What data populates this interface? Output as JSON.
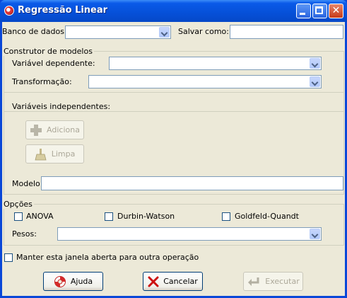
{
  "window": {
    "title": "Regressão Linear"
  },
  "top": {
    "banco_label": "Banco de dados:",
    "banco_value": "",
    "salvar_label": "Salvar como:",
    "salvar_value": ""
  },
  "builder": {
    "group_label": "Construtor de modelos",
    "dep_label": "Variável dependente:",
    "dep_value": "",
    "transf_label": "Transformação:",
    "transf_value": "",
    "indep_label": "Variáveis independentes:",
    "add_label": "Adiciona",
    "clear_label": "Limpa",
    "model_label": "Modelo:",
    "model_value": ""
  },
  "options": {
    "group_label": "Opções",
    "anova_label": "ANOVA",
    "anova_checked": false,
    "dw_label": "Durbin-Watson",
    "dw_checked": false,
    "gq_label": "Goldfeld-Quandt",
    "gq_checked": false,
    "pesos_label": "Pesos:",
    "pesos_value": ""
  },
  "keep_open": {
    "label": "Manter esta janela aberta para outra operação",
    "checked": false
  },
  "buttons": {
    "help": "Ajuda",
    "cancel": "Cancelar",
    "execute": "Executar"
  },
  "icons": {
    "app": "app-icon",
    "add": "plus-icon",
    "clear": "broom-icon",
    "help": "lifebuoy-icon",
    "cancel": "x-icon",
    "execute": "enter-arrow-icon"
  },
  "colors": {
    "titlebar": "#0650d8",
    "client": "#ece9d8",
    "cancel_x": "#cc1010"
  }
}
